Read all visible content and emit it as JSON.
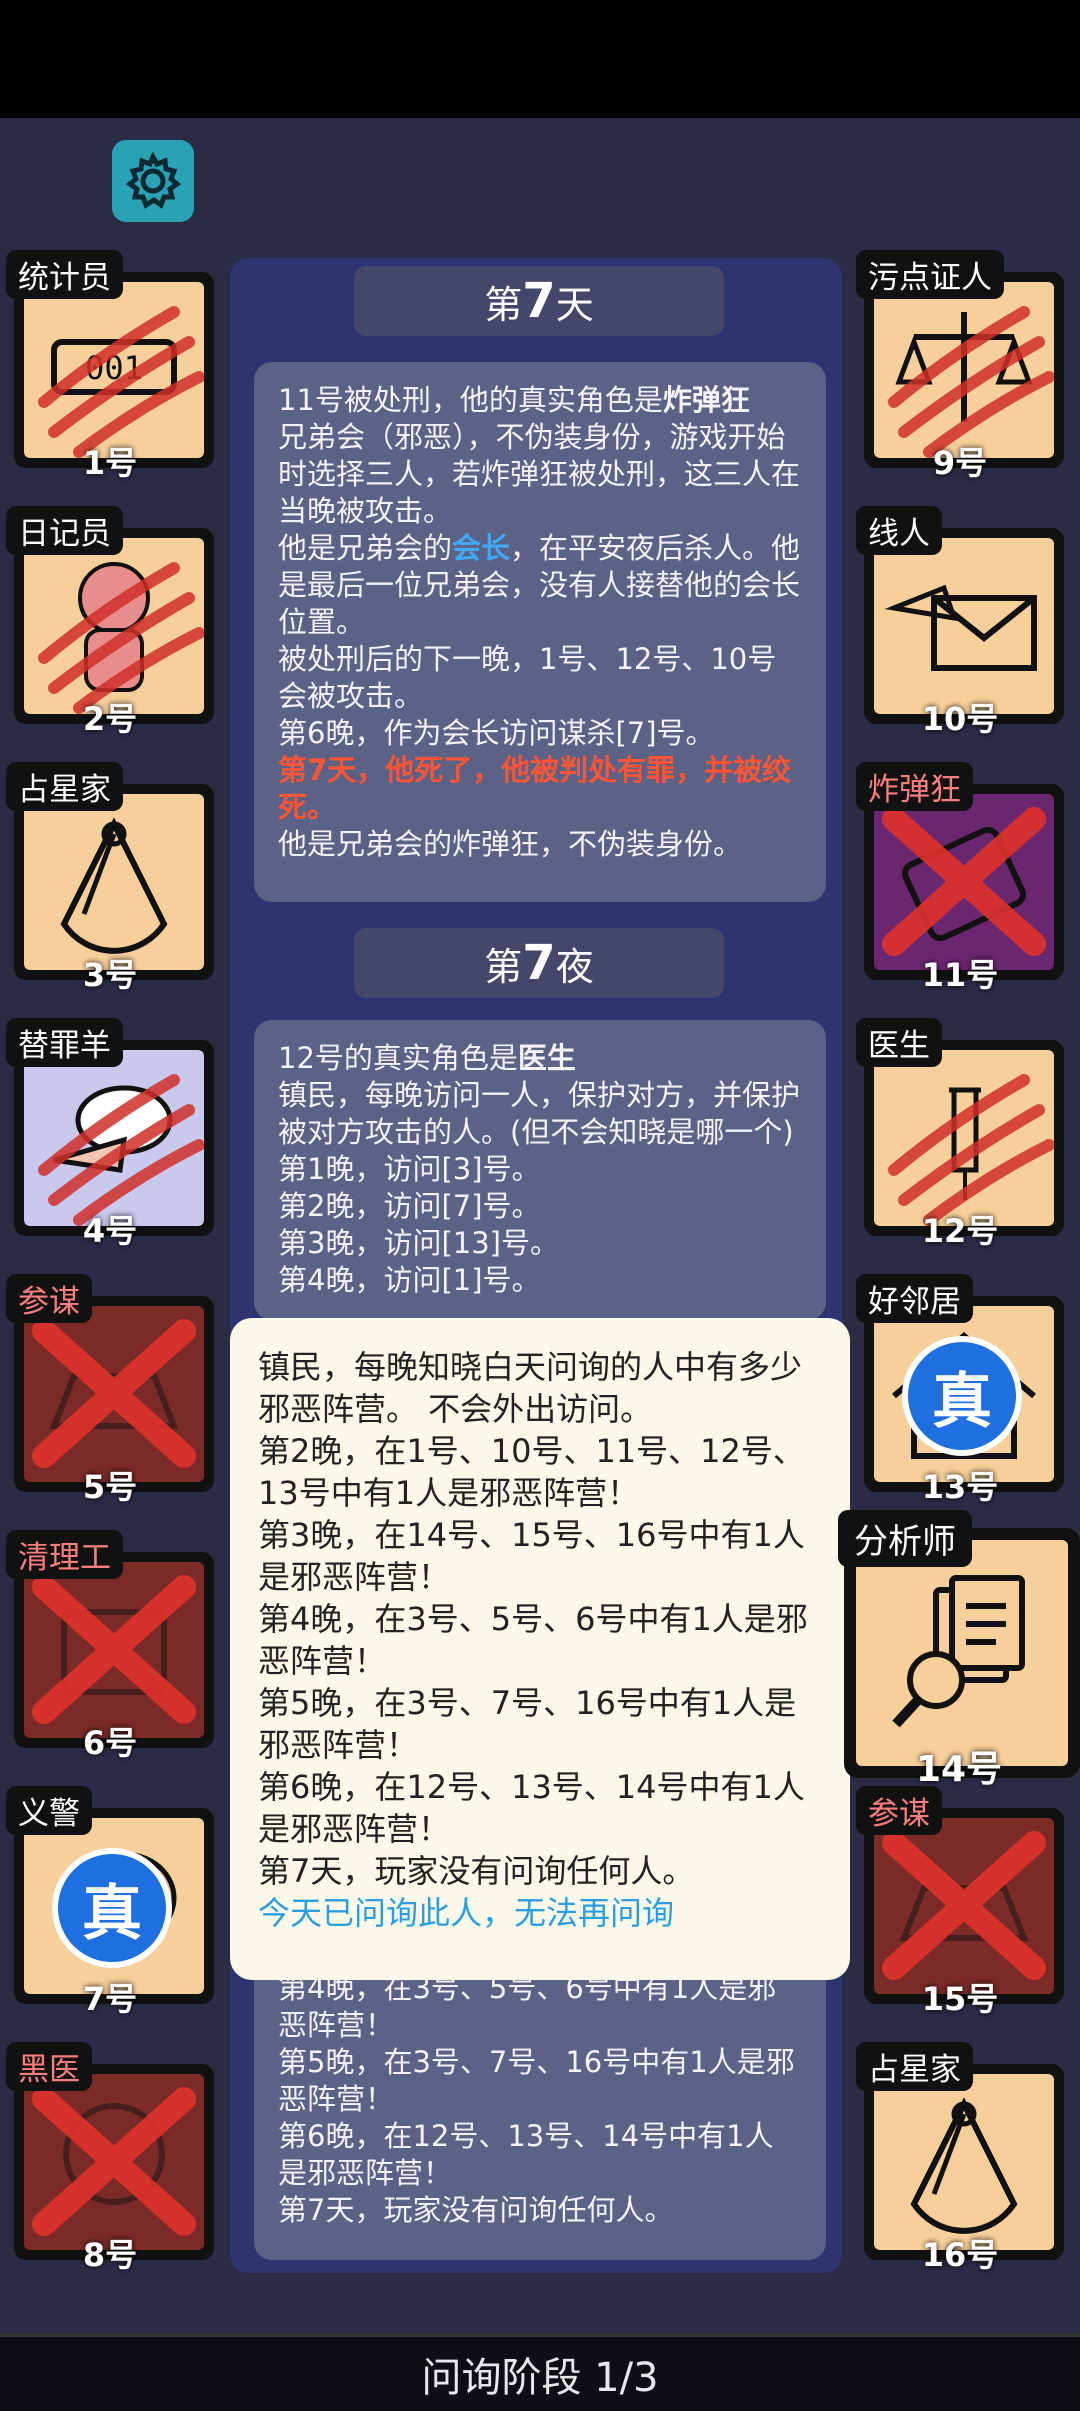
{
  "top_bar": {},
  "settings": {
    "icon": "gear-icon"
  },
  "day_header": {
    "prefix": "第",
    "num": "7",
    "suffix": "天"
  },
  "night_header": {
    "prefix": "第",
    "num": "7",
    "suffix": "夜"
  },
  "day_log": {
    "l1a": "11号被处刑，他的真实角色是",
    "l1b": "炸弹狂",
    "l2": "兄弟会（邪恶），不伪装身份，游戏开始时选择三人，若炸弹狂被处刑，这三人在当晚被攻击。",
    "l3a": "他是兄弟会的",
    "l3b": "会长",
    "l3c": "，在平安夜后杀人。他是最后一位兄弟会，没有人接替他的会长位置。",
    "l4": "被处刑后的下一晚，1号、12号、10号会被攻击。",
    "l5": "第6晚，作为会长访问谋杀[7]号。",
    "l6": "第7天，他死了，他被判处有罪，并被绞死。",
    "l7": "他是兄弟会的炸弹狂，不伪装身份。"
  },
  "night_log": {
    "l1a": "12号的真实角色是",
    "l1b": "医生",
    "l2": "镇民，每晚访问一人，保护对方，并保护被对方攻击的人。(但不会知晓是哪一个)",
    "l3": "第1晚，访问[3]号。",
    "l4": "第2晚，访问[7]号。",
    "l5": "第3晚，访问[13]号。",
    "l6": "第4晚，访问[1]号。"
  },
  "under_log": {
    "l1": "第4晚，在3号、5号、6号中有1人是邪恶阵营！",
    "l2": "第5晚，在3号、7号、16号中有1人是邪恶阵营！",
    "l3": "第6晚，在12号、13号、14号中有1人是邪恶阵营！",
    "l4": "第7天，玩家没有问询任何人。"
  },
  "popup": {
    "l1": "镇民，每晚知晓白天问询的人中有多少邪恶阵营。 不会外出访问。",
    "l2": "第2晚，在1号、10号、11号、12号、13号中有1人是邪恶阵营！",
    "l3": "第3晚，在14号、15号、16号中有1人是邪恶阵营！",
    "l4": "第4晚，在3号、5号、6号中有1人是邪恶阵营！",
    "l5": "第5晚，在3号、7号、16号中有1人是邪恶阵营！",
    "l6": "第6晚，在12号、13号、14号中有1人是邪恶阵营！",
    "l7": "第7天，玩家没有问询任何人。",
    "l8": "今天已问询此人，无法再问询"
  },
  "players_left": [
    {
      "role": "统计员",
      "num": "1号",
      "icon": "counter-icon",
      "state": "clawed"
    },
    {
      "role": "日记员",
      "num": "2号",
      "icon": "doll-icon",
      "state": "clawed"
    },
    {
      "role": "占星家",
      "num": "3号",
      "icon": "sextant-icon",
      "state": "alive"
    },
    {
      "role": "替罪羊",
      "num": "4号",
      "icon": "sheep-icon",
      "state": "clawed"
    },
    {
      "role": "参谋",
      "num": "5号",
      "icon": "hat-icon",
      "state": "dead"
    },
    {
      "role": "清理工",
      "num": "6号",
      "icon": "machine-icon",
      "state": "dead"
    },
    {
      "role": "义警",
      "num": "7号",
      "icon": "fist-icon",
      "state": "true"
    },
    {
      "role": "黑医",
      "num": "8号",
      "icon": "mask-icon",
      "state": "dead"
    }
  ],
  "players_right": [
    {
      "role": "污点证人",
      "num": "9号",
      "icon": "scales-icon",
      "state": "clawed"
    },
    {
      "role": "线人",
      "num": "10号",
      "icon": "envelope-icon",
      "state": "alive"
    },
    {
      "role": "炸弹狂",
      "num": "11号",
      "icon": "bomb-icon",
      "state": "dead"
    },
    {
      "role": "医生",
      "num": "12号",
      "icon": "syringe-icon",
      "state": "clawed"
    },
    {
      "role": "好邻居",
      "num": "13号",
      "icon": "house-icon",
      "state": "true"
    },
    {
      "role": "参谋",
      "num": "15号",
      "icon": "hat-icon",
      "state": "dead"
    },
    {
      "role": "占星家",
      "num": "16号",
      "icon": "sextant-icon",
      "state": "alive"
    }
  ],
  "analyst": {
    "role": "分析师",
    "num": "14号",
    "icon": "magnifier-documents-icon"
  },
  "true_badge": "真",
  "footer": {
    "phase": "问询阶段 1/3"
  }
}
